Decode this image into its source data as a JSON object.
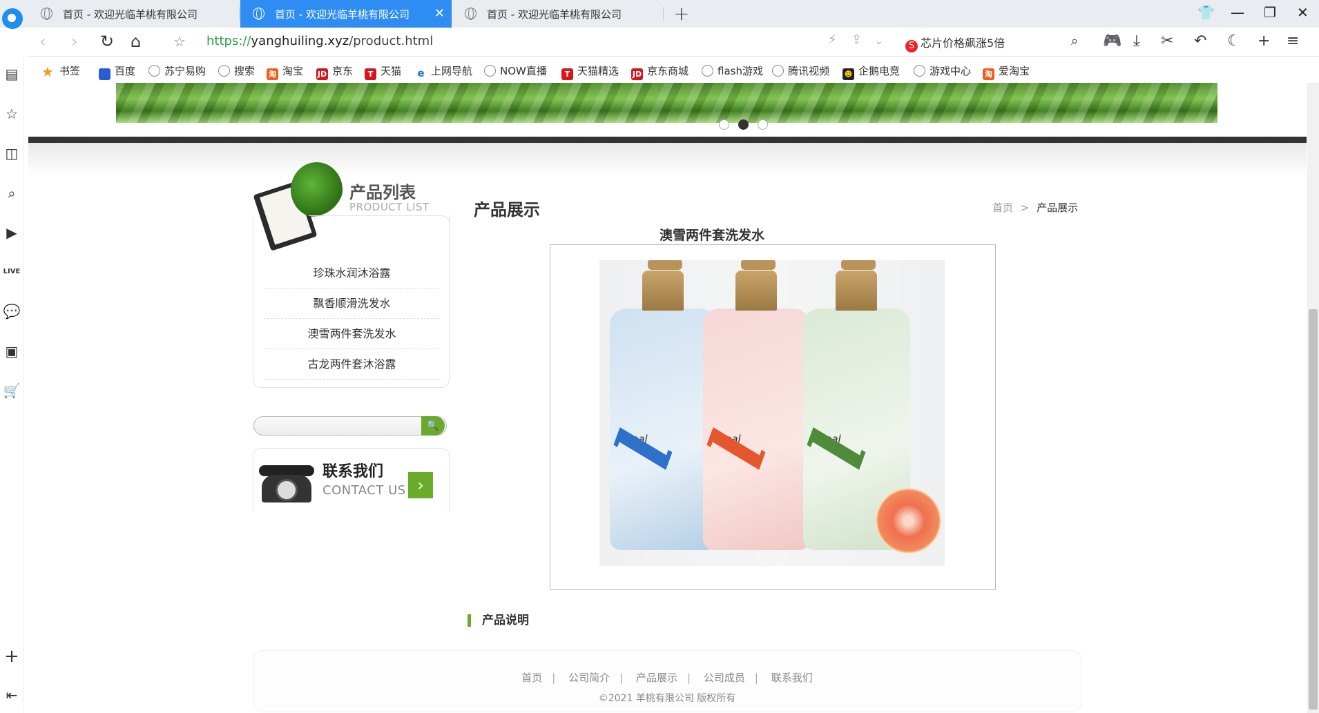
{
  "browser": {
    "tabs": [
      {
        "title": "首页 - 欢迎光临羊桃有限公司",
        "active": false
      },
      {
        "title": "首页 - 欢迎光临羊桃有限公司",
        "active": true
      },
      {
        "title": "首页 - 欢迎光临羊桃有限公司",
        "active": false
      }
    ],
    "url_scheme": "https://",
    "url_domain": "yanghuiling.xyz",
    "url_path": "/product.html",
    "search_hint": "芯片价格飙涨5倍",
    "bookmarks": [
      "书签",
      "百度",
      "苏宁易购",
      "搜索",
      "淘宝",
      "京东",
      "天猫",
      "上网导航",
      "NOW直播",
      "天猫精选",
      "京东商城",
      "flash游戏",
      "腾讯视频",
      "企鹅电竞",
      "游戏中心",
      "爱淘宝"
    ]
  },
  "sidebar_left": {
    "title_cn": "产品列表",
    "title_en": "PRODUCT LIST",
    "products": [
      "珍珠水润沐浴露",
      "飘香顺滑洗发水",
      "澳雪两件套洗发水",
      "古龙两件套沐浴露"
    ],
    "search_button": "🔍",
    "contact_cn": "联系我们",
    "contact_en": "CONTACT US"
  },
  "main": {
    "section_title": "产品展示",
    "breadcrumb": {
      "home": "首页",
      "separator": ">",
      "current": "产品展示"
    },
    "product_name": "澳雪两件套洗发水",
    "description_heading": "产品说明"
  },
  "footer": {
    "nav": [
      "首页",
      "公司简介",
      "产品展示",
      "公司成员",
      "联系我们"
    ],
    "copyright": "©2021  羊桃有限公司  版权所有"
  },
  "colors": {
    "tab_active": "#2e8df3",
    "accent_green": "#6aa92a",
    "url_green": "#2aa148"
  }
}
